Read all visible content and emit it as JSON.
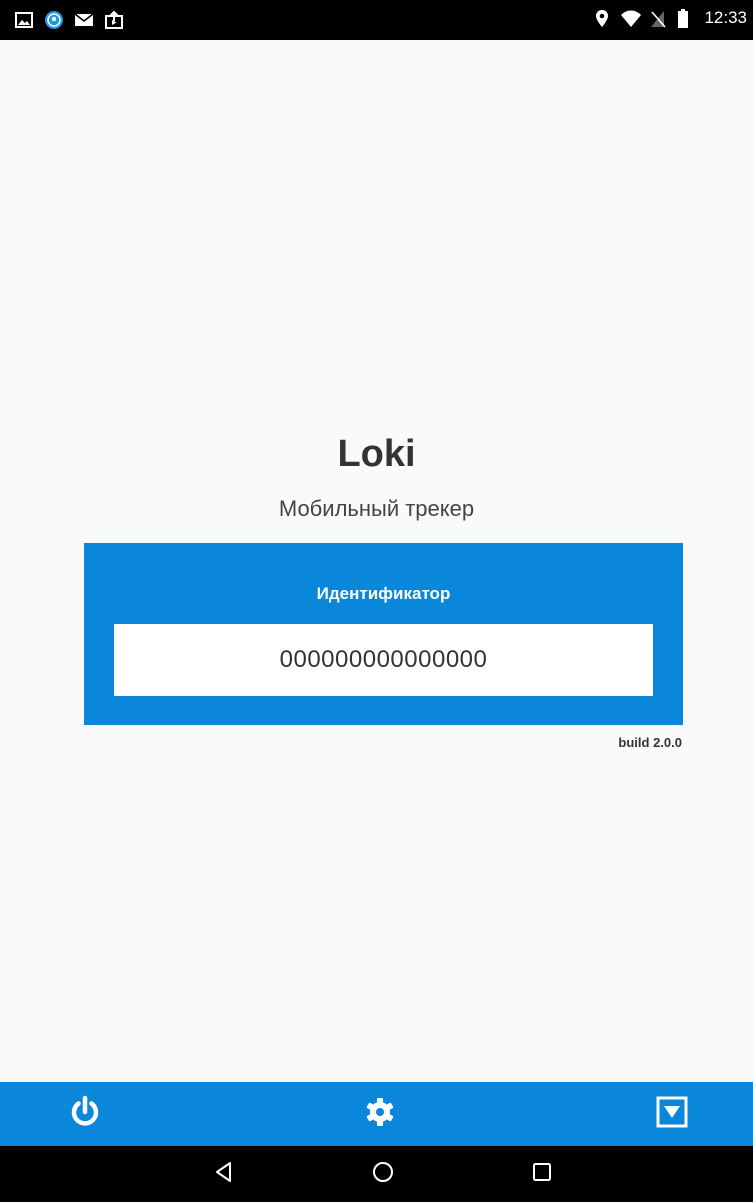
{
  "status_bar": {
    "time": "12:33",
    "left_icons": [
      "image-icon",
      "location-pin-app-icon",
      "mail-icon",
      "media-upload-icon"
    ],
    "right_icons": [
      "location-icon",
      "wifi-icon",
      "no-sim-icon",
      "battery-icon"
    ]
  },
  "app": {
    "title": "Loki",
    "subtitle": "Мобильный трекер"
  },
  "identifier": {
    "label": "Идентификатор",
    "value": "000000000000000"
  },
  "build": {
    "label": "build 2.0.0"
  },
  "toolbar": {
    "buttons": [
      "power-icon",
      "gear-icon",
      "dropdown-box-icon"
    ]
  },
  "nav": {
    "buttons": [
      "back-icon",
      "home-icon",
      "recents-icon"
    ]
  },
  "colors": {
    "accent": "#0a86db",
    "background": "#fafafa",
    "status_bar": "#000000"
  }
}
